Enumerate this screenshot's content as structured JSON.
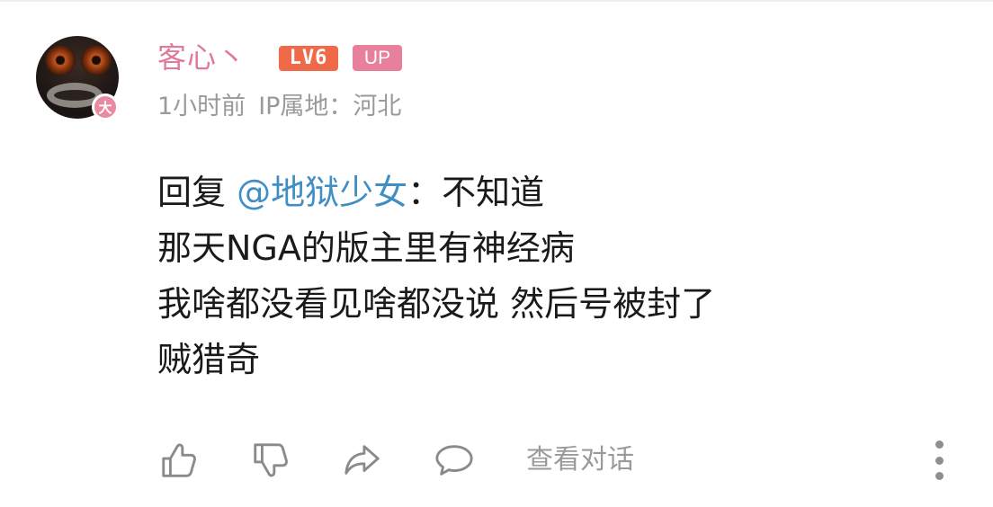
{
  "comment": {
    "user": {
      "name": "客心丶",
      "level_badge": "LV6",
      "up_badge": "UP",
      "avatar_badge": "大"
    },
    "meta": {
      "time": "1小时前",
      "location": "IP属地：河北"
    },
    "content": {
      "reply_prefix": "回复",
      "mention": "@地狱少女",
      "reply_sep": "：",
      "reply_text": "不知道",
      "lines": [
        "那天NGA的版主里有神经病",
        "我啥都没看见啥都没说 然后号被封了",
        "贼猎奇"
      ]
    },
    "actions": {
      "like_icon": "thumbs-up-icon",
      "dislike_icon": "thumbs-down-icon",
      "share_icon": "share-icon",
      "reply_icon": "comment-icon",
      "view_conversation_label": "查看对话",
      "more_icon": "more-vertical-icon"
    },
    "colors": {
      "username": "#e07a98",
      "level_badge": "#f06a4a",
      "up_badge": "#e8809c",
      "mention": "#3f8ec4",
      "meta": "#9a9a9a"
    }
  }
}
